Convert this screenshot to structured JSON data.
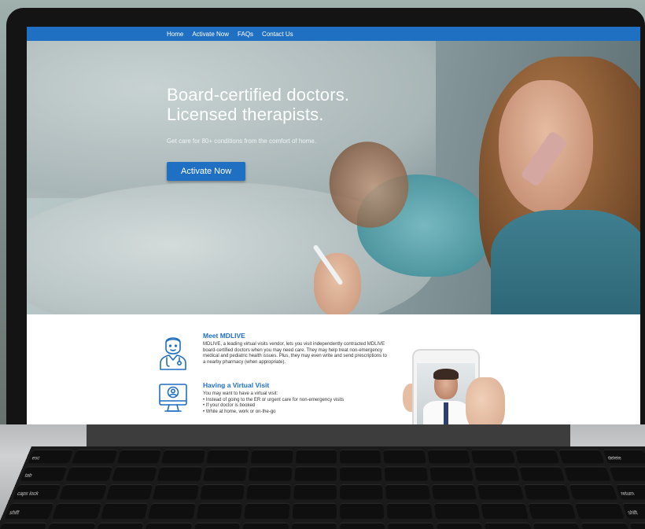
{
  "nav": {
    "items": [
      "Home",
      "Activate Now",
      "FAQs",
      "Contact Us"
    ]
  },
  "hero": {
    "title_line1": "Board-certified doctors.",
    "title_line2": "Licensed therapists.",
    "subtitle": "Get care for 80+ conditions from the comfort of home.",
    "cta_label": "Activate Now"
  },
  "meet": {
    "heading": "Meet MDLIVE",
    "body": "MDLIVE, a leading virtual visits vendor, lets you visit independently contracted MDLIVE board-certified doctors when you may need care. They may help treat non-emergency medical and pediatric health issues. Plus, they may even write and send prescriptions to a nearby pharmacy (when appropriate)."
  },
  "visit": {
    "heading": "Having a Virtual Visit",
    "intro": "You may want to have a virtual visit:",
    "bullets": [
      "Instead of going to the ER or urgent care for non-emergency visits",
      "If your doctor is booked",
      "While at home, work or on-the-go"
    ]
  },
  "keyboard": {
    "labels": [
      "esc",
      "tab",
      "caps lock",
      "shift",
      "delete",
      "return",
      "shift"
    ]
  },
  "colors": {
    "brand_blue": "#1f6fc2",
    "heading_blue": "#1f6fc2"
  },
  "icons": {
    "doctor": "doctor-icon",
    "video_call": "video-call-icon"
  }
}
